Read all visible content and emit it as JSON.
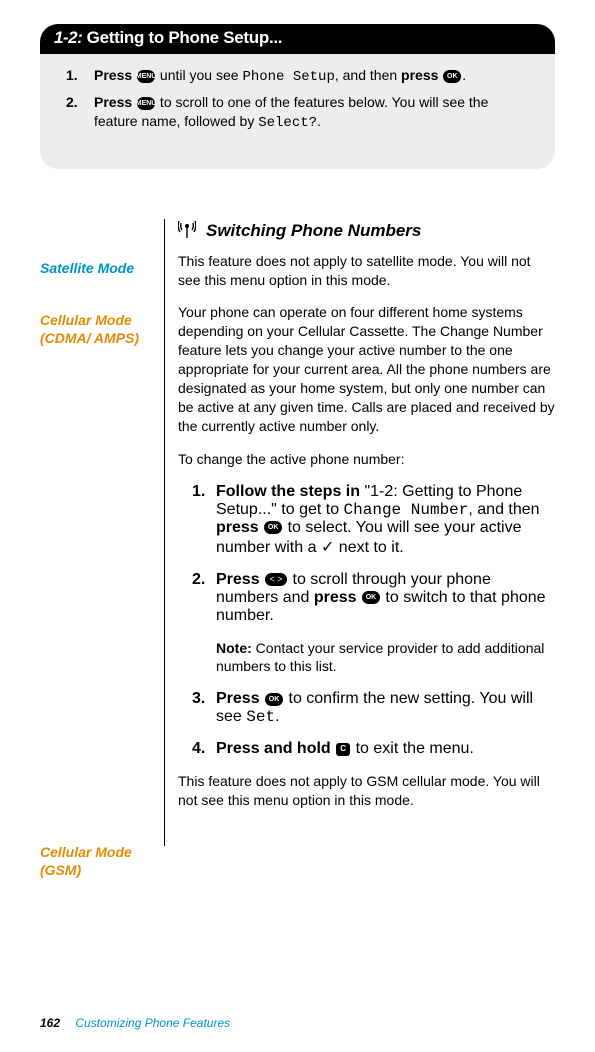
{
  "banner": {
    "num": "1-2:",
    "title": "Getting to Phone Setup..."
  },
  "steps": [
    {
      "num": "1.",
      "pre": "Press ",
      "icon1": "MENU",
      "mid1": " until you see ",
      "lcd": "Phone Setup",
      "mid2": ", and then ",
      "b2": "press ",
      "icon2": "OK",
      "post": "."
    },
    {
      "num": "2.",
      "pre": "Press ",
      "icon1": "MENU",
      "mid1": " to scroll to one of the features below. You will see the feature name, followed by ",
      "lcd": "Select?",
      "post": "."
    }
  ],
  "subheader": {
    "icon": "📡",
    "title": "Switching Phone Numbers"
  },
  "sidebar": {
    "sat": "Satellite Mode",
    "cdma": "Cellular Mode (CDMA/ AMPS)",
    "gsm": "Cellular Mode (GSM)"
  },
  "sat_para": "This feature does not apply to satellite mode. You will not see this menu option in this mode.",
  "cdma_para": "Your phone can operate on four different home systems depending on your Cellular Cassette. The Change Number feature lets you change your active number to the one appropriate for your current area. All the phone numbers are designated as your home system, but only one number can be active at any given time. Calls are placed and received by the currently active number only.",
  "to_change": "To change the active phone number:",
  "instr": [
    {
      "num": "1.",
      "b1": "Follow the steps in",
      "t1": " \"1-2: Getting to Phone Setup...\" to get to ",
      "lcd": "Change Number",
      "t2": ", and then ",
      "b2": "press ",
      "icon": "OK",
      "t3": " to select. You will see your active number with a ",
      "check": "✓",
      "t4": " next to it."
    },
    {
      "num": "2.",
      "b1": "Press ",
      "icon1": "< >",
      "t1": "  to scroll through your phone numbers and ",
      "b2": "press ",
      "icon2": "OK",
      "t2": " to switch to that phone number."
    }
  ],
  "note": {
    "b": "Note:",
    "t": " Contact your service provider to add additional numbers to this list."
  },
  "instr2": [
    {
      "num": "3.",
      "b1": "Press ",
      "icon": "OK",
      "t1": " to confirm the new setting. You will see ",
      "lcd": "Set",
      "t2": "."
    },
    {
      "num": "4.",
      "b1": "Press and hold ",
      "icon": "C",
      "t1": " to exit the menu."
    }
  ],
  "gsm_para": "This feature does not apply to GSM cellular mode. You will not see this menu option in this mode.",
  "footer": {
    "page": "162",
    "section": "Customizing Phone Features"
  }
}
